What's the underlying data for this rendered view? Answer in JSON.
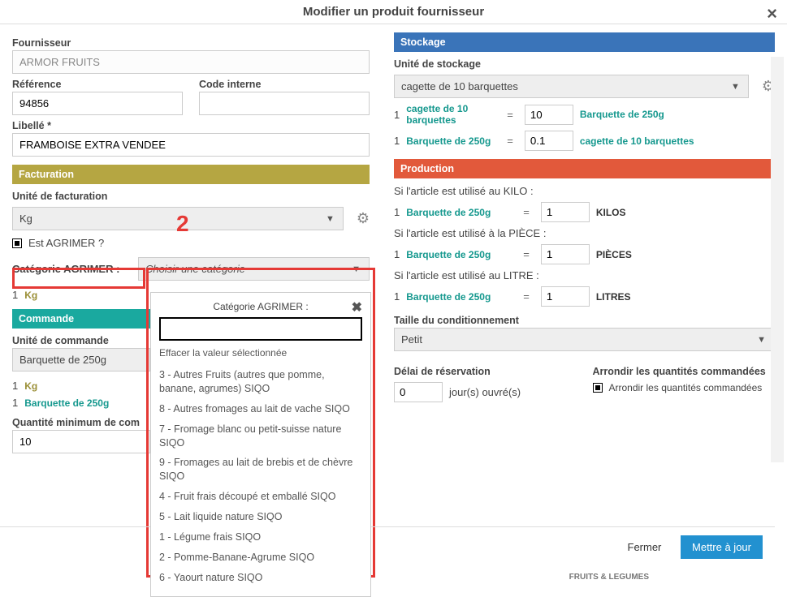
{
  "modal": {
    "title": "Modifier un produit fournisseur"
  },
  "left": {
    "fournisseur_label": "Fournisseur",
    "fournisseur_value": "ARMOR FRUITS",
    "reference_label": "Référence",
    "reference_value": "94856",
    "code_interne_label": "Code interne",
    "code_interne_value": "",
    "libelle_label": "Libellé *",
    "libelle_value": "FRAMBOISE EXTRA VENDEE",
    "facturation_header": "Facturation",
    "unite_facturation_label": "Unité de facturation",
    "unite_facturation_value": "Kg",
    "est_agrimer_label": "Est AGRIMER ?",
    "categorie_agrimer_label": "Catégorie AGRIMER :",
    "categorie_agrimer_placeholder": "Choisir une catégorie",
    "conv_qty1": "1",
    "conv_unit1": "Kg",
    "commande_header": "Commande",
    "unite_commande_label": "Unité de commande",
    "unite_commande_value": "Barquette de 250g",
    "conv_qty2": "1",
    "conv_unit2": "Kg",
    "conv_qty3": "1",
    "conv_unit3": "Barquette de 250g",
    "qty_min_label": "Quantité minimum de com",
    "qty_min_value": "10"
  },
  "dropdown": {
    "title": "Catégorie AGRIMER :",
    "clear": "Effacer la valeur sélectionnée",
    "options": [
      "3 - Autres Fruits (autres que pomme, banane, agrumes) SIQO",
      "8 - Autres fromages au lait de vache SIQO",
      "7 - Fromage blanc ou petit-suisse nature SIQO",
      "9 - Fromages au lait de brebis et de chèvre SIQO",
      "4 - Fruit frais découpé et emballé SIQO",
      "5 - Lait liquide nature SIQO",
      "1 - Légume frais SIQO",
      "2 - Pomme-Banane-Agrume SIQO",
      "6 - Yaourt nature SIQO"
    ]
  },
  "right": {
    "stockage_header": "Stockage",
    "unite_stockage_label": "Unité de stockage",
    "unite_stockage_value": "cagette de 10 barquettes",
    "s_row1_qty": "1",
    "s_row1_left": "cagette de 10 barquettes",
    "s_row1_val": "10",
    "s_row1_right": "Barquette de 250g",
    "s_row2_qty": "1",
    "s_row2_left": "Barquette de 250g",
    "s_row2_val": "0.1",
    "s_row2_right": "cagette de 10 barquettes",
    "production_header": "Production",
    "prod_kilo_label": "Si l'article est utilisé au KILO :",
    "prod_piece_label": "Si l'article est utilisé à la PIÈCE :",
    "prod_litre_label": "Si l'article est utilisé au LITRE :",
    "prod_unit": "Barquette de 250g",
    "prod_one": "1",
    "prod_kilo_unit": "KILOS",
    "prod_piece_unit": "PIÈCES",
    "prod_litre_unit": "LITRES",
    "cond_label": "Taille du conditionnement",
    "cond_value": "Petit",
    "delai_label": "Délai de réservation",
    "delai_value": "0",
    "delai_suffix": "jour(s) ouvré(s)",
    "arrondir_header": "Arrondir les quantités commandées",
    "arrondir_check_label": "Arrondir les quantités commandées"
  },
  "footer": {
    "fermer": "Fermer",
    "maj": "Mettre à jour"
  },
  "annotation": {
    "two": "2"
  },
  "bg": {
    "fruits": "FRUITS & LEGUMES"
  }
}
